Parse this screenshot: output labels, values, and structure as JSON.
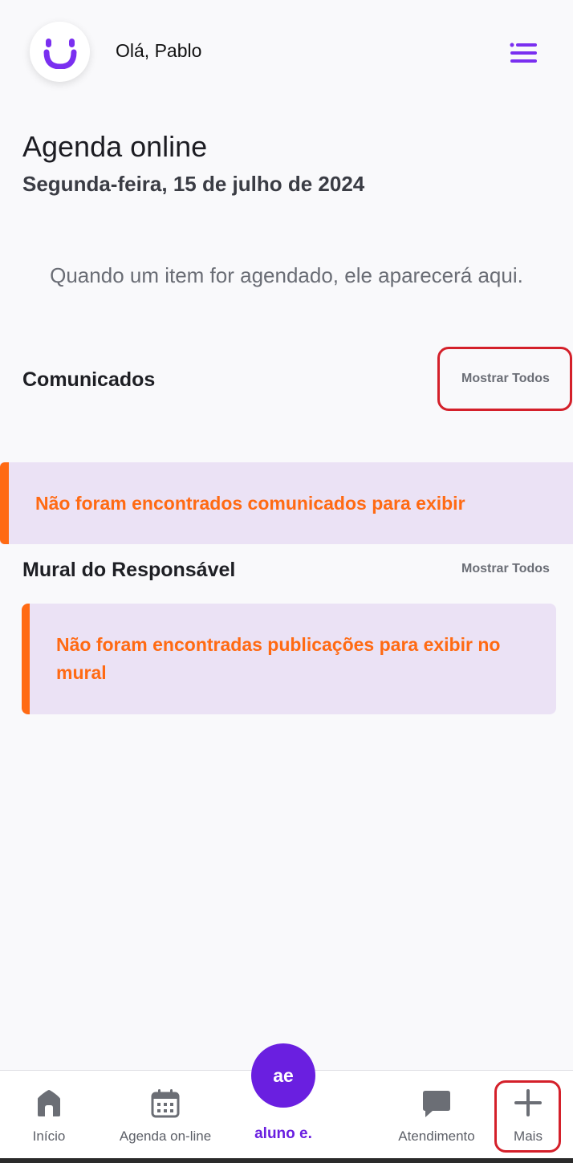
{
  "header": {
    "greeting": "Olá, Pablo",
    "logo_icon": "smile-logo-icon",
    "menu_icon": "hamburger-menu-icon"
  },
  "agenda": {
    "title": "Agenda online",
    "date": "Segunda-feira, 15 de julho de 2024",
    "empty_message": "Quando um item for agendado, ele aparecerá aqui."
  },
  "comunicados": {
    "title": "Comunicados",
    "show_all": "Mostrar Todos",
    "empty_notice": "Não foram encontrados comunicados para exibir"
  },
  "mural": {
    "title": "Mural do Responsável",
    "show_all": "Mostrar Todos",
    "empty_notice": "Não foram encontradas publicações para exibir no mural"
  },
  "bottom_nav": {
    "items": [
      {
        "label": "Início",
        "icon": "home-icon"
      },
      {
        "label": "Agenda on-line",
        "icon": "calendar-icon"
      },
      {
        "label": "Atendimento",
        "icon": "chat-bubble-icon"
      },
      {
        "label": "Mais",
        "icon": "plus-icon"
      }
    ],
    "avatar": {
      "initials": "ae",
      "label": "aluno e."
    }
  },
  "colors": {
    "brand_purple": "#6a1fe0",
    "accent_orange": "#ff6a13",
    "notice_background": "#ebe2f5",
    "highlight_red": "#d4202a"
  }
}
